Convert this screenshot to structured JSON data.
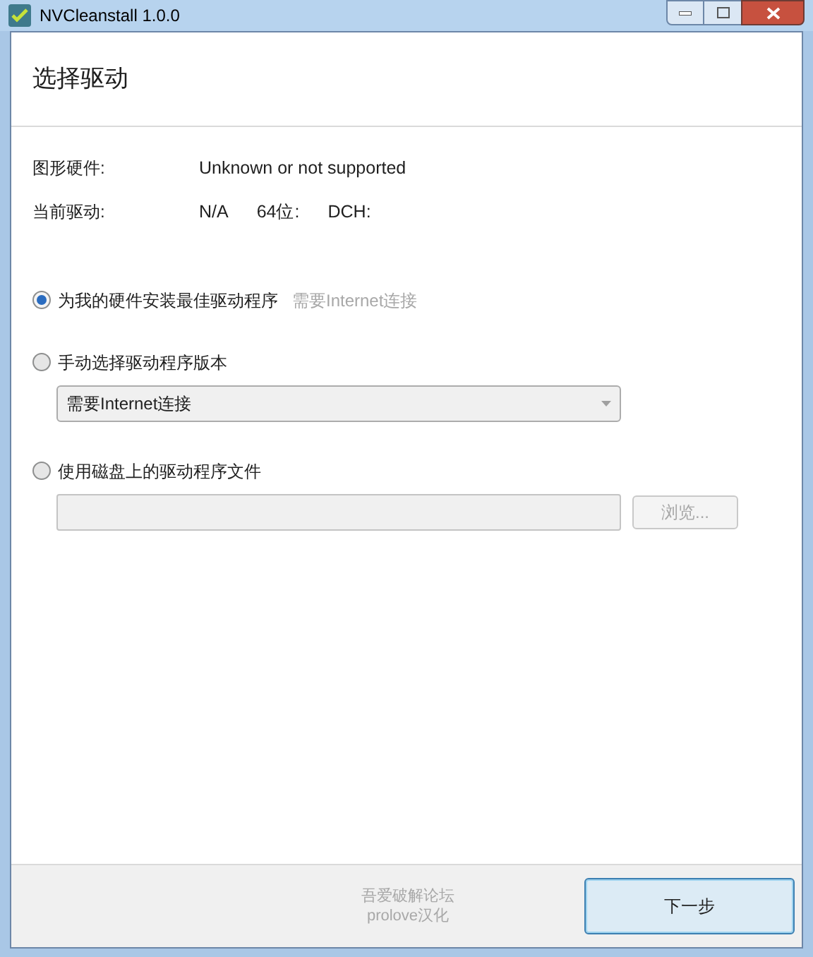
{
  "window": {
    "title": "NVCleanstall 1.0.0"
  },
  "header": {
    "title": "选择驱动"
  },
  "info": [
    {
      "label": "图形硬件:",
      "values": [
        "Unknown or not supported"
      ]
    },
    {
      "label": "当前驱动:",
      "values": [
        "N/A",
        "64位:",
        "DCH:"
      ]
    }
  ],
  "options": [
    {
      "kind": "plain",
      "label": "为我的硬件安装最佳驱动程序",
      "hint": "需要Internet连接",
      "selected": true
    },
    {
      "kind": "dropdown",
      "label": "手动选择驱动程序版本",
      "dropdown": {
        "value": "需要Internet连接"
      },
      "selected": false
    },
    {
      "kind": "file",
      "label": "使用磁盘上的驱动程序文件",
      "field": {
        "disabled": true
      },
      "browse": {
        "label": "浏览...",
        "disabled": true
      },
      "selected": false
    }
  ],
  "footer": {
    "credit": [
      "吾爱破解论坛",
      "prolove汉化"
    ],
    "next_button": "下一步"
  }
}
